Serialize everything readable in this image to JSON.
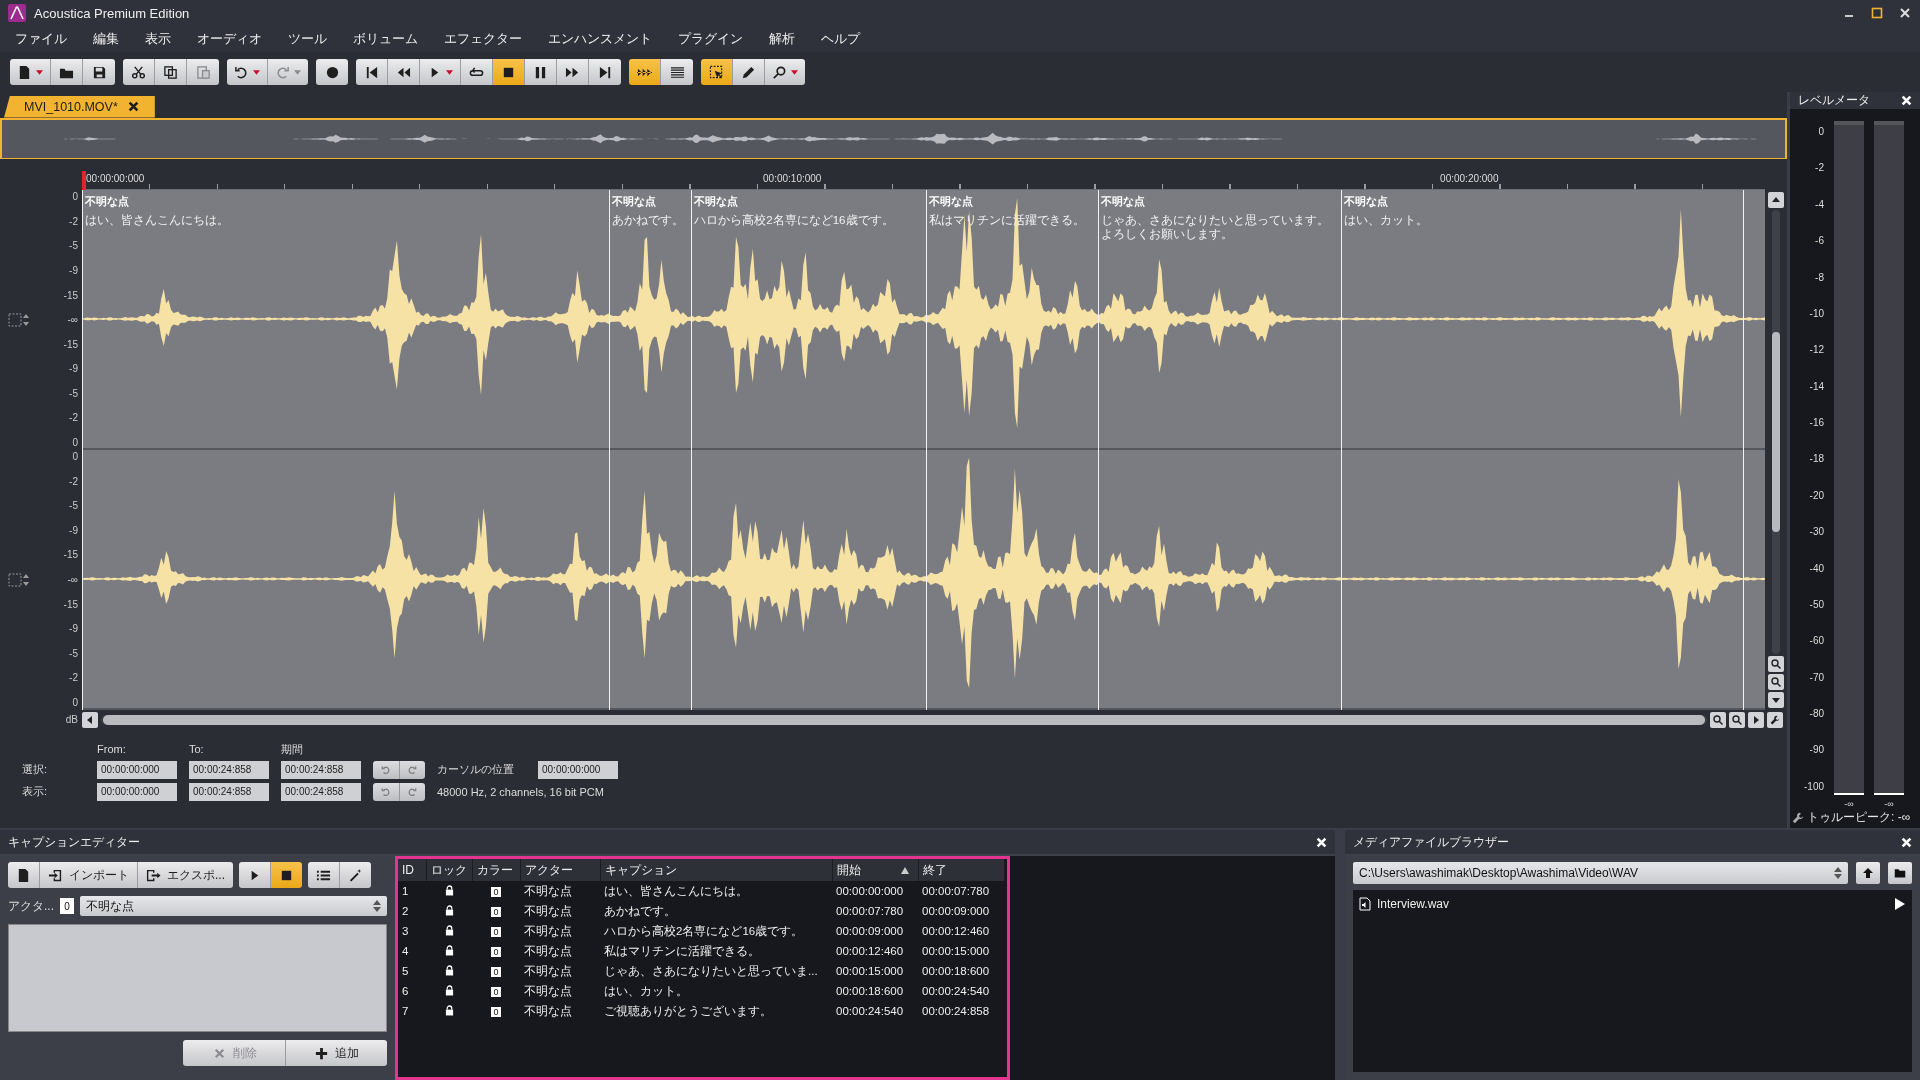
{
  "window": {
    "title": "Acoustica Premium Edition"
  },
  "menu": [
    "ファイル",
    "編集",
    "表示",
    "オーディオ",
    "ツール",
    "ボリューム",
    "エフェクター",
    "エンハンスメント",
    "プラグイン",
    "解析",
    "ヘルプ"
  ],
  "toolbar": [
    [
      {
        "kind": "new",
        "dropdown": true,
        "active": false,
        "disabled": false
      },
      {
        "kind": "open",
        "dropdown": false,
        "active": false,
        "disabled": false
      },
      {
        "kind": "save",
        "dropdown": false,
        "active": false,
        "disabled": false
      }
    ],
    [
      {
        "kind": "cut",
        "dropdown": false,
        "active": false,
        "disabled": false
      },
      {
        "kind": "copy",
        "dropdown": false,
        "active": false,
        "disabled": false
      },
      {
        "kind": "paste",
        "dropdown": false,
        "active": false,
        "disabled": true
      }
    ],
    [
      {
        "kind": "undo",
        "dropdown": true,
        "active": false,
        "disabled": false
      },
      {
        "kind": "redo",
        "dropdown": true,
        "active": false,
        "disabled": true
      }
    ],
    [
      {
        "kind": "record",
        "dropdown": false,
        "active": false,
        "disabled": false
      }
    ],
    [
      {
        "kind": "to-start",
        "dropdown": false,
        "active": false,
        "disabled": false
      },
      {
        "kind": "rewind",
        "dropdown": false,
        "active": false,
        "disabled": false
      },
      {
        "kind": "play",
        "dropdown": true,
        "active": false,
        "disabled": false
      },
      {
        "kind": "loop",
        "dropdown": false,
        "active": false,
        "disabled": false
      },
      {
        "kind": "stop",
        "dropdown": false,
        "active": true,
        "disabled": false
      },
      {
        "kind": "pause",
        "dropdown": false,
        "active": false,
        "disabled": false
      },
      {
        "kind": "forward",
        "dropdown": false,
        "active": false,
        "disabled": false
      },
      {
        "kind": "to-end",
        "dropdown": false,
        "active": false,
        "disabled": false
      }
    ],
    [
      {
        "kind": "follow",
        "dropdown": false,
        "active": true,
        "disabled": false
      },
      {
        "kind": "spectrum",
        "dropdown": false,
        "active": false,
        "disabled": false
      }
    ],
    [
      {
        "kind": "select",
        "dropdown": false,
        "active": true,
        "disabled": false
      },
      {
        "kind": "pencil",
        "dropdown": false,
        "active": false,
        "disabled": false
      },
      {
        "kind": "zoom",
        "dropdown": true,
        "active": false,
        "disabled": false
      }
    ]
  ],
  "document_tabs": [
    {
      "label": "MVI_1010.MOV*",
      "selected": true
    }
  ],
  "ruler": {
    "labels": [
      "00:00:00:000",
      "00:00:10:000",
      "00:00:20:000"
    ]
  },
  "track": {
    "unit": "dB",
    "channels": [
      {
        "db_scale": [
          "0",
          "-2",
          "-5",
          "-9",
          "-15",
          "-∞",
          "-15",
          "-9",
          "-5",
          "-2",
          "0"
        ]
      },
      {
        "db_scale": [
          "0",
          "-2",
          "-5",
          "-9",
          "-15",
          "-∞",
          "-15",
          "-9",
          "-5",
          "-2",
          "0"
        ]
      }
    ],
    "markers": [
      {
        "actor": "不明な点",
        "text": "はい、皆さんこんにちは。"
      },
      {
        "actor": "不明な点",
        "text": "あかねです。"
      },
      {
        "actor": "不明な点",
        "text": "ハロから高校2名専になど16歳です。"
      },
      {
        "actor": "不明な点",
        "text": "私はマリチンに活躍できる。"
      },
      {
        "actor": "不明な点",
        "text": "じゃあ、さあになりたいと思っています。よろしくお願いします。"
      },
      {
        "actor": "不明な点",
        "text": "はい、カット。"
      }
    ]
  },
  "selection": {
    "headers": [
      "From:",
      "To:",
      "期間"
    ],
    "rows": [
      {
        "label": "選択:",
        "values": [
          "00:00:00:000",
          "00:00:24:858",
          "00:00:24:858"
        ]
      },
      {
        "label": "表示:",
        "values": [
          "00:00:00:000",
          "00:00:24:858",
          "00:00:24:858"
        ]
      }
    ],
    "cursor_label": "カーソルの位置",
    "cursor_value": "00:00:00:000",
    "format": "48000 Hz, 2 channels, 16 bit PCM"
  },
  "level_meter": {
    "title": "レベルメータ",
    "scale": [
      "0",
      "-2",
      "-4",
      "-6",
      "-8",
      "-10",
      "-12",
      "-14",
      "-16",
      "-18",
      "-20",
      "-30",
      "-40",
      "-50",
      "-60",
      "-70",
      "-80",
      "-90",
      "-100"
    ],
    "channels": [
      {
        "reading": "-∞",
        "level": 0
      },
      {
        "reading": "-∞",
        "level": 0
      }
    ],
    "true_peak": "トゥルーピーク: -∞"
  },
  "caption_editor": {
    "title": "キャプションエディター",
    "import": "インポート",
    "export": "エクスポ...",
    "actor_label": "アクタ...",
    "actor_color": "0",
    "actor_value": "不明な点",
    "delete": "削除",
    "delete_disabled": true,
    "add": "追加",
    "columns": [
      {
        "label": "ID",
        "sorted": false
      },
      {
        "label": "ロック",
        "sorted": false
      },
      {
        "label": "カラー",
        "sorted": false
      },
      {
        "label": "アクター",
        "sorted": false
      },
      {
        "label": "キャプション",
        "sorted": false
      },
      {
        "label": "開始",
        "sorted": true
      },
      {
        "label": "終了",
        "sorted": false
      }
    ],
    "rows": [
      {
        "id": "1",
        "locked": true,
        "color_index": "0",
        "actor": "不明な点",
        "caption": "はい、皆さんこんにちは。",
        "start": "00:00:00:000",
        "end": "00:00:07:780"
      },
      {
        "id": "2",
        "locked": true,
        "color_index": "0",
        "actor": "不明な点",
        "caption": "あかねです。",
        "start": "00:00:07:780",
        "end": "00:00:09:000"
      },
      {
        "id": "3",
        "locked": true,
        "color_index": "0",
        "actor": "不明な点",
        "caption": "ハロから高校2名専になど16歳です。",
        "start": "00:00:09:000",
        "end": "00:00:12:460"
      },
      {
        "id": "4",
        "locked": true,
        "color_index": "0",
        "actor": "不明な点",
        "caption": "私はマリチンに活躍できる。",
        "start": "00:00:12:460",
        "end": "00:00:15:000"
      },
      {
        "id": "5",
        "locked": true,
        "color_index": "0",
        "actor": "不明な点",
        "caption": "じゃあ、さあになりたいと思っていま...",
        "start": "00:00:15:000",
        "end": "00:00:18:600"
      },
      {
        "id": "6",
        "locked": true,
        "color_index": "0",
        "actor": "不明な点",
        "caption": "はい、カット。",
        "start": "00:00:18:600",
        "end": "00:00:24:540"
      },
      {
        "id": "7",
        "locked": true,
        "color_index": "0",
        "actor": "不明な点",
        "caption": "ご視聴ありがとうございます。",
        "start": "00:00:24:540",
        "end": "00:00:24:858"
      }
    ]
  },
  "media_browser": {
    "title": "メディアファイルブラウザー",
    "path": "C:\\Users\\awashimak\\Desktop\\Awashima\\Video\\WAV",
    "files": [
      {
        "name": "Interview.wav"
      }
    ]
  }
}
